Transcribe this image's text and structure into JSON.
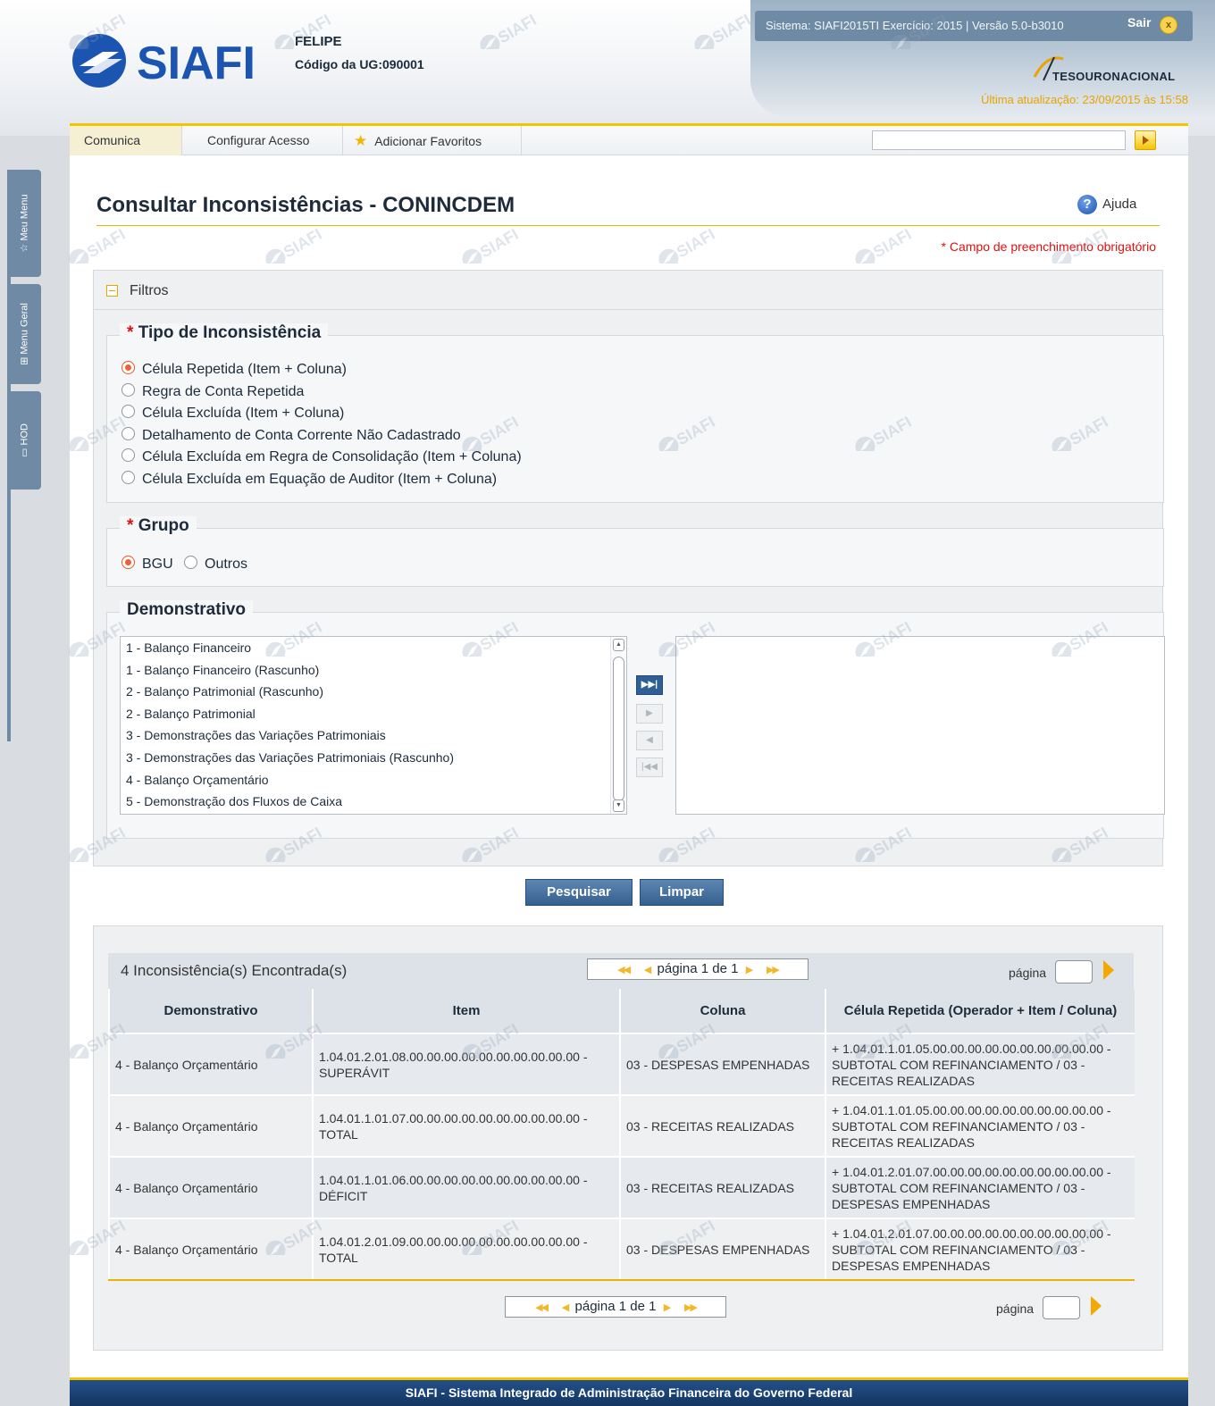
{
  "header": {
    "logo_text": "SIAFI",
    "user_name": "FELIPE",
    "ug_label": "Código da UG:",
    "ug_value": "090001",
    "sistema": "Sistema: SIAFI2015TI Exercício: 2015 | Versão 5.0-b3010",
    "sair_label": "Sair",
    "sair_close": "x",
    "tesouro": "TESOURONACIONAL",
    "ultima_atualizacao": "Última atualização: 23/09/2015 às 15:58"
  },
  "side_tabs": {
    "meu_menu": "Meu Menu",
    "menu_geral": "Menu Geral",
    "hod": "HOD"
  },
  "menubar": {
    "items": [
      "Comunica",
      "Configurar Acesso",
      "Adicionar Favoritos"
    ],
    "search_value": ""
  },
  "page": {
    "title": "Consultar Inconsistências - CONINCDEM",
    "help": "Ajuda",
    "required_note": "* Campo de preenchimento obrigatório"
  },
  "filtros": {
    "label": "Filtros",
    "tipo": {
      "required": "*",
      "legend": "Tipo de Inconsistência",
      "options": [
        "Célula Repetida (Item + Coluna)",
        "Regra de Conta Repetida",
        "Célula Excluída (Item + Coluna)",
        "Detalhamento de Conta Corrente Não Cadastrado",
        "Célula Excluída em Regra de Consolidação (Item + Coluna)",
        "Célula Excluída em Equação de Auditor (Item + Coluna)"
      ],
      "selected_index": 0
    },
    "grupo": {
      "required": "*",
      "legend": "Grupo",
      "options": [
        "BGU",
        "Outros"
      ],
      "selected_index": 0
    },
    "demonstrativo": {
      "legend": "Demonstrativo",
      "available": [
        "1 - Balanço Financeiro",
        "1 - Balanço Financeiro (Rascunho)",
        "2 - Balanço Patrimonial (Rascunho)",
        "2 - Balanço Patrimonial",
        "3 - Demonstrações das Variações Patrimoniais",
        "3 - Demonstrações das Variações Patrimoniais (Rascunho)",
        "4 - Balanço Orçamentário",
        "5 - Demonstração dos Fluxos de Caixa"
      ],
      "selected": []
    }
  },
  "actions": {
    "pesquisar": "Pesquisar",
    "limpar": "Limpar"
  },
  "results": {
    "found": "4 Inconsistência(s) Encontrada(s)",
    "pager": "página 1 de 1",
    "pagina_label": "página",
    "pagina_value": "",
    "columns": [
      "Demonstrativo",
      "Item",
      "Coluna",
      "Célula Repetida (Operador + Item / Coluna)"
    ],
    "rows": [
      [
        "4 - Balanço Orçamentário",
        "1.04.01.2.01.08.00.00.00.00.00.00.00.00.00.00 - SUPERÁVIT",
        "03 - DESPESAS EMPENHADAS",
        "+ 1.04.01.1.01.05.00.00.00.00.00.00.00.00.00.00 - SUBTOTAL COM REFINANCIAMENTO / 03 - RECEITAS REALIZADAS"
      ],
      [
        "4 - Balanço Orçamentário",
        "1.04.01.1.01.07.00.00.00.00.00.00.00.00.00.00 - TOTAL",
        "03 - RECEITAS REALIZADAS",
        "+ 1.04.01.1.01.05.00.00.00.00.00.00.00.00.00.00 - SUBTOTAL COM REFINANCIAMENTO / 03 - RECEITAS REALIZADAS"
      ],
      [
        "4 - Balanço Orçamentário",
        "1.04.01.1.01.06.00.00.00.00.00.00.00.00.00.00 - DÉFICIT",
        "03 - RECEITAS REALIZADAS",
        "+ 1.04.01.2.01.07.00.00.00.00.00.00.00.00.00.00 - SUBTOTAL COM REFINANCIAMENTO / 03 - DESPESAS EMPENHADAS"
      ],
      [
        "4 - Balanço Orçamentário",
        "1.04.01.2.01.09.00.00.00.00.00.00.00.00.00.00 - TOTAL",
        "03 - DESPESAS EMPENHADAS",
        "+ 1.04.01.2.01.07.00.00.00.00.00.00.00.00.00.00 - SUBTOTAL COM REFINANCIAMENTO / 03 - DESPESAS EMPENHADAS"
      ]
    ]
  },
  "footer": {
    "text": "SIAFI - Sistema Integrado de Administração Financeira do Governo Federal"
  },
  "colors": {
    "accent": "#f4c400",
    "brand_blue": "#1c54b2",
    "header_bar": "#6f8aa5",
    "required_red": "#e01010",
    "button_blue": "#34608f"
  },
  "icons": [
    "star-icon",
    "help-icon",
    "close-icon",
    "arrow-right-icon",
    "move-all-right-icon",
    "move-right-icon",
    "move-left-icon",
    "move-all-left-icon",
    "first-page-icon",
    "prev-page-icon",
    "next-page-icon",
    "last-page-icon",
    "monitor-icon",
    "sitemap-icon",
    "siafi-watermark-icon"
  ]
}
